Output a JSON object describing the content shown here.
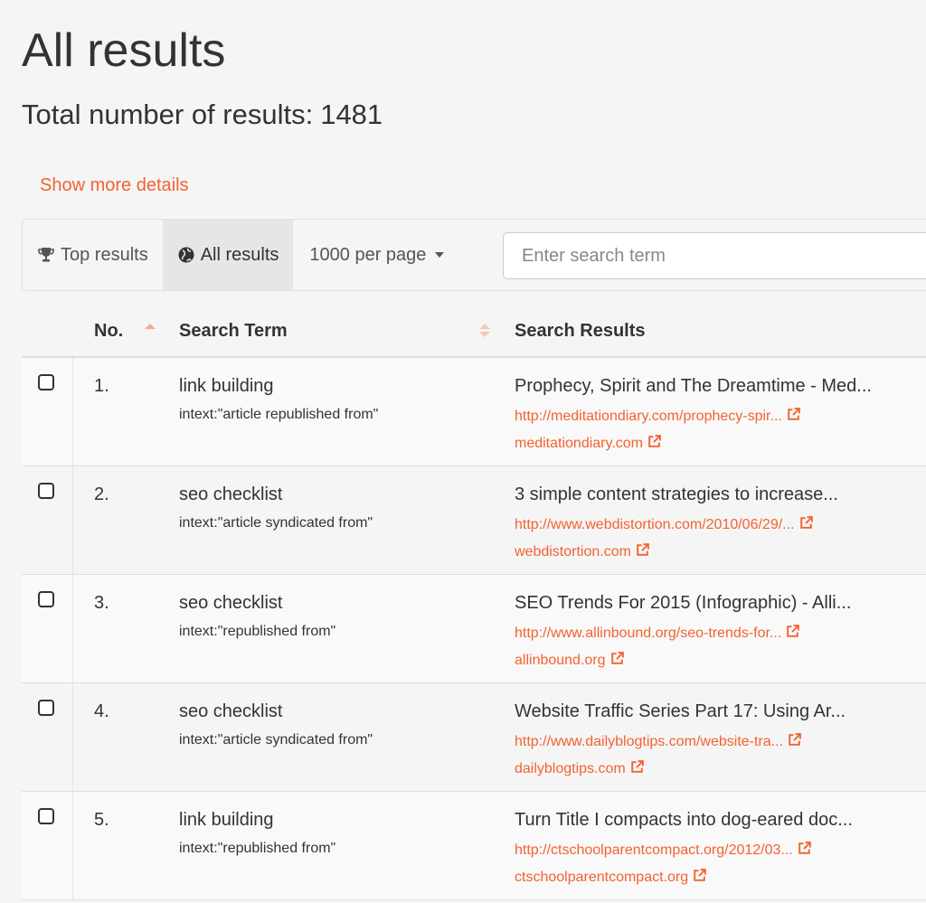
{
  "header": {
    "title": "All results",
    "total_label": "Total number of results:",
    "total_value": "1481",
    "details_link": "Show more details"
  },
  "toolbar": {
    "top_results": "Top results",
    "all_results": "All results",
    "per_page": "1000 per page",
    "search_placeholder": "Enter search term"
  },
  "table": {
    "columns": {
      "no": "No.",
      "term": "Search Term",
      "results": "Search Results"
    },
    "rows": [
      {
        "no": "1.",
        "term": "link building",
        "query": "intext:\"article republished from\"",
        "title": "Prophecy, Spirit and The Dreamtime - Med...",
        "url": "http://meditationdiary.com/prophecy-spir...",
        "domain": "meditationdiary.com"
      },
      {
        "no": "2.",
        "term": "seo checklist",
        "query": "intext:\"article syndicated from\"",
        "title": "3 simple content strategies to increase...",
        "url": "http://www.webdistortion.com/2010/06/29/...",
        "domain": "webdistortion.com"
      },
      {
        "no": "3.",
        "term": "seo checklist",
        "query": "intext:\"republished from\"",
        "title": "SEO Trends For 2015 (Infographic) - Alli...",
        "url": "http://www.allinbound.org/seo-trends-for...",
        "domain": "allinbound.org"
      },
      {
        "no": "4.",
        "term": "seo checklist",
        "query": "intext:\"article syndicated from\"",
        "title": "Website Traffic Series Part 17: Using Ar...",
        "url": "http://www.dailyblogtips.com/website-tra...",
        "domain": "dailyblogtips.com"
      },
      {
        "no": "5.",
        "term": "link building",
        "query": "intext:\"republished from\"",
        "title": "Turn Title I compacts into dog-eared doc...",
        "url": "http://ctschoolparentcompact.org/2012/03...",
        "domain": "ctschoolparentcompact.org"
      }
    ]
  },
  "colors": {
    "accent": "#f4622f",
    "sort_active": "#f6a98a",
    "text": "#333333"
  },
  "icons": {
    "top_results": "trophy-icon",
    "all_results": "globe-icon",
    "link": "external-link-icon"
  }
}
